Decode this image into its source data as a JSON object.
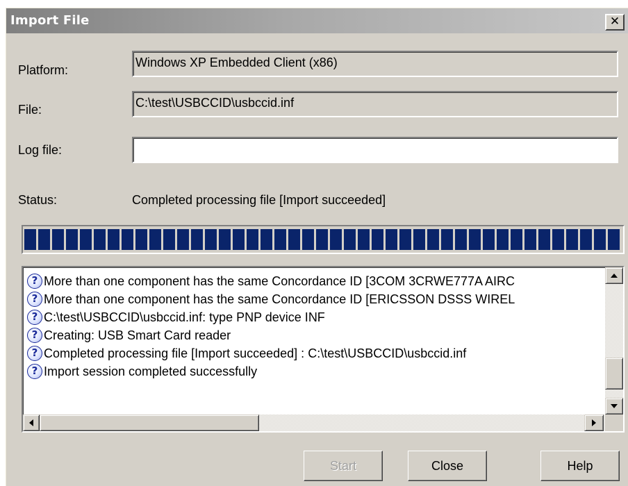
{
  "window": {
    "title": "Import File",
    "close_glyph": "✕"
  },
  "form": {
    "platform_label": "Platform:",
    "platform_value": "Windows XP Embedded Client (x86)",
    "file_label": "File:",
    "file_value": "C:\\test\\USBCCID\\usbccid.inf",
    "logfile_label": "Log file:",
    "logfile_value": "",
    "status_label": "Status:",
    "status_value": "Completed processing file [Import succeeded]"
  },
  "progress": {
    "fraction": 1.0
  },
  "log": {
    "icon": "info-question-icon",
    "rows": [
      "More than one component has the same Concordance ID [3COM 3CRWE777A AIRC",
      "More than one component has the same Concordance ID [ERICSSON DSSS WIREL",
      "C:\\test\\USBCCID\\usbccid.inf: type PNP device INF",
      "Creating: USB Smart Card reader",
      "Completed processing file [Import succeeded]  : C:\\test\\USBCCID\\usbccid.inf",
      "Import session completed successfully"
    ]
  },
  "buttons": {
    "start": "Start",
    "close": "Close",
    "help": "Help"
  },
  "colors": {
    "dialog_bg": "#d4d0c8",
    "progress_fill": "#0a246a",
    "icon_blue": "#1a2a9a"
  }
}
